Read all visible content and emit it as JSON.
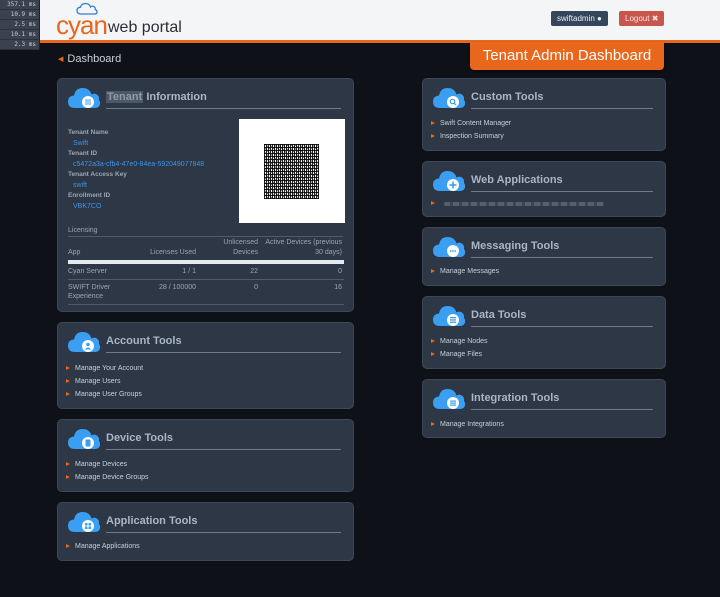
{
  "timing": [
    "357.1 ms",
    "10.9 ms",
    "2.5 ms",
    "10.1 ms",
    "2.3 ms"
  ],
  "header": {
    "logo_cyan": "cyan",
    "logo_rest": "web portal",
    "user_label": "swiftadmin",
    "logout_label": "Logout",
    "dashboard_tab": "Tenant Admin Dashboard"
  },
  "breadcrumb": "Dashboard",
  "tenant": {
    "title_highlight": "Tenant",
    "title_rest": "Information",
    "name_label": "Tenant Name",
    "name_value": "Swift",
    "id_label": "Tenant ID",
    "id_value": "c5472a3a-cfb4-47e0-84ea-592049077848",
    "key_label": "Tenant Access Key",
    "key_value": "swift",
    "enroll_label": "Enrollment ID",
    "enroll_value": "VBK7CO",
    "licensing_title": "Licensing",
    "table_headers": [
      "App",
      "Licenses Used",
      "Unlicensed Devices",
      "Active Devices (previous 30 days)"
    ],
    "rows": [
      [
        "Cyan Server",
        "1 / 1",
        "22",
        "0"
      ],
      [
        "SWIFT Driver Experience",
        "28 / 100000",
        "0",
        "16"
      ]
    ]
  },
  "account_tools": {
    "title": "Account Tools",
    "items": [
      "Manage Your Account",
      "Manage Users",
      "Manage User Groups"
    ]
  },
  "device_tools": {
    "title": "Device Tools",
    "items": [
      "Manage Devices",
      "Manage Device Groups"
    ]
  },
  "application_tools": {
    "title": "Application Tools",
    "items": [
      "Manage Applications"
    ]
  },
  "custom_tools": {
    "title": "Custom Tools",
    "items": [
      "Swift Content Manager",
      "Inspection Summary"
    ]
  },
  "web_applications": {
    "title": "Web Applications"
  },
  "messaging_tools": {
    "title": "Messaging Tools",
    "items": [
      "Manage Messages"
    ]
  },
  "data_tools": {
    "title": "Data Tools",
    "items": [
      "Manage Nodes",
      "Manage Files"
    ]
  },
  "integration_tools": {
    "title": "Integration Tools",
    "items": [
      "Manage Integrations"
    ]
  },
  "colors": {
    "accent": "#e8671d",
    "link_blue": "#3f94e8",
    "panel_bg": "#2d3745",
    "page_bg": "#0e1117"
  }
}
